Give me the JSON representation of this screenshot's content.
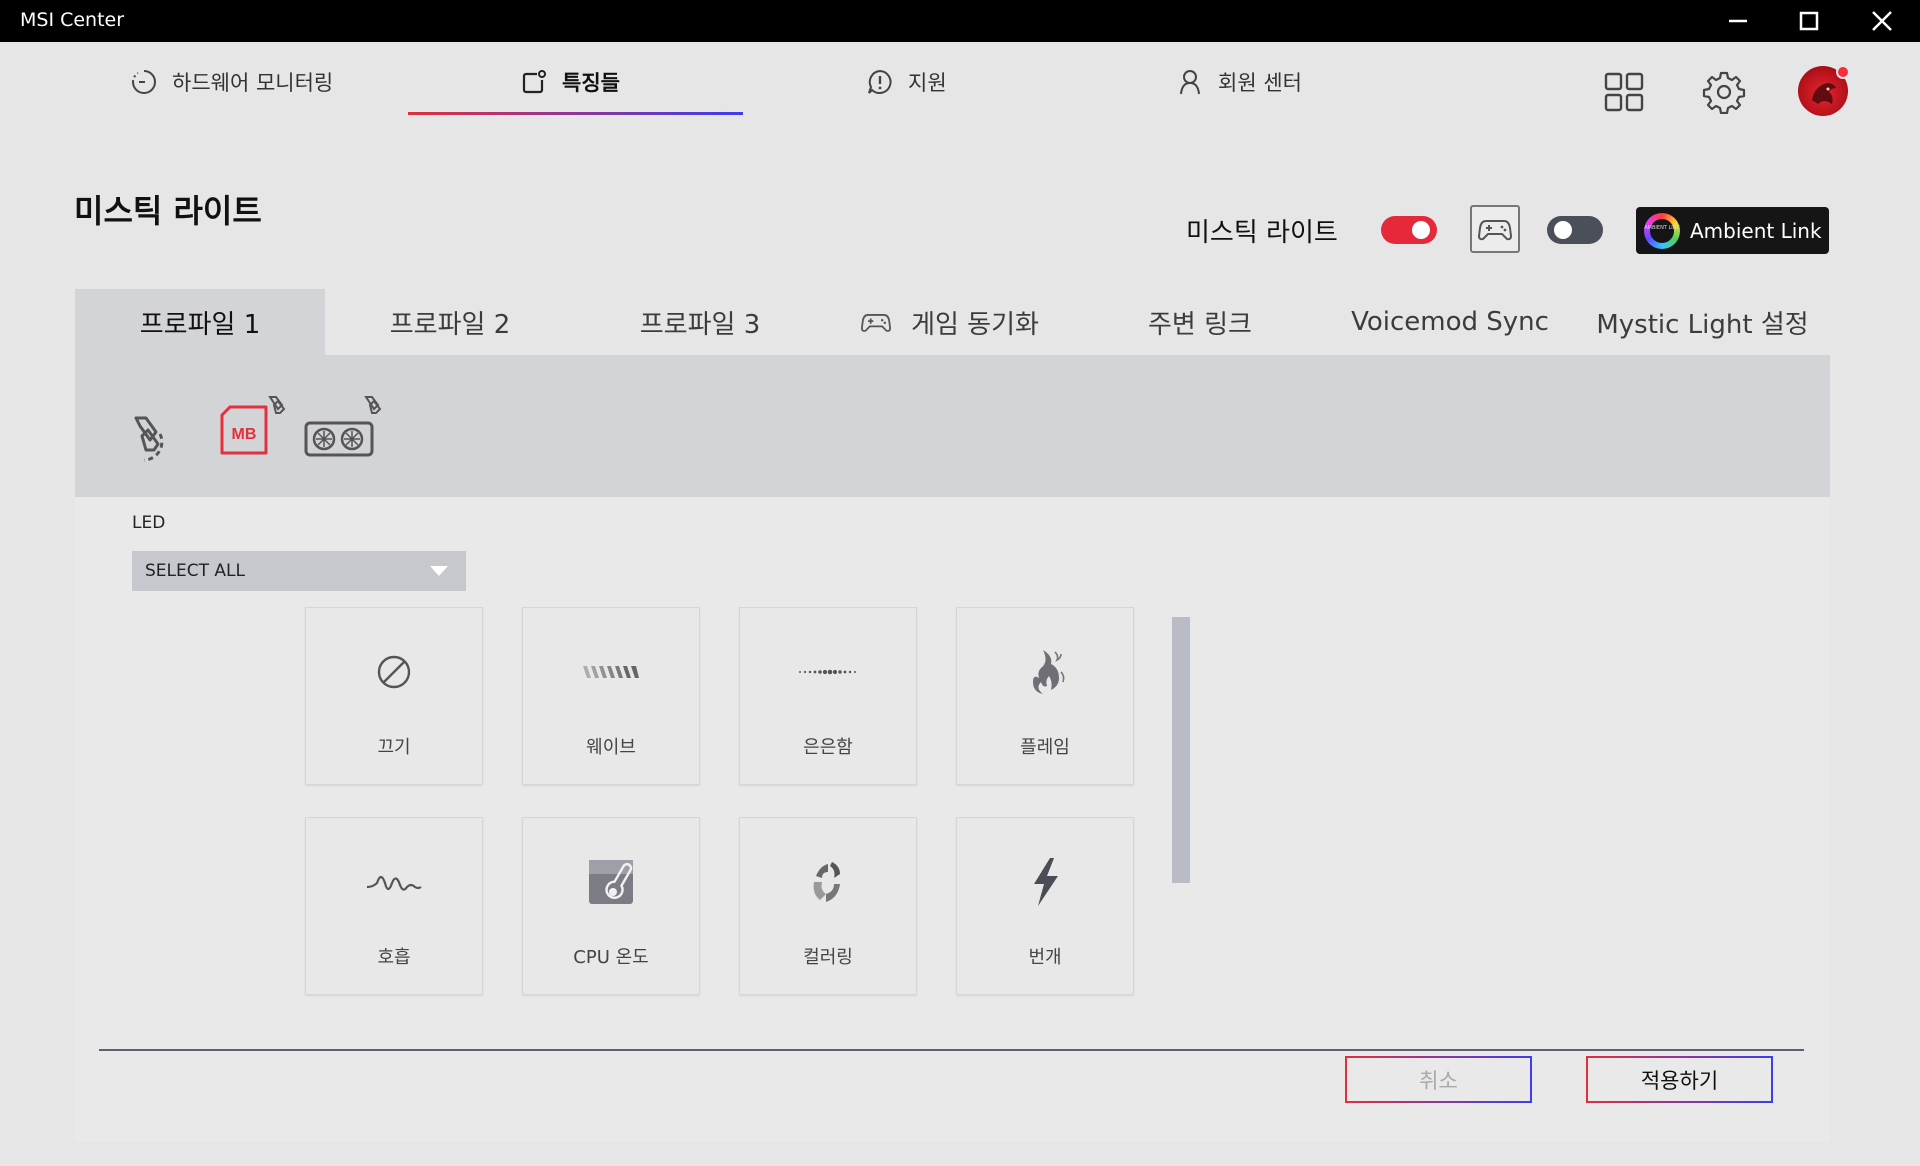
{
  "window": {
    "title": "MSI Center"
  },
  "nav": {
    "tabs": [
      {
        "label": "하드웨어 모니터링",
        "icon": "gauge-icon"
      },
      {
        "label": "특징들",
        "icon": "features-icon",
        "active": true
      },
      {
        "label": "지원",
        "icon": "support-alert-icon"
      },
      {
        "label": "회원 센터",
        "icon": "user-icon"
      }
    ],
    "accent_gradient": [
      "#e0303c",
      "#3d3df0"
    ]
  },
  "page": {
    "title": "미스틱 라이트"
  },
  "header": {
    "mystic_light_label": "미스틱 라이트",
    "mystic_light_toggle": "on",
    "game_sync_toggle": "off",
    "ambient_link_label": "Ambient Link",
    "ambient_logo_text": "AMBIENT LINK"
  },
  "profile_tabs": [
    {
      "label": "프로파일 1",
      "active": true
    },
    {
      "label": "프로파일 2"
    },
    {
      "label": "프로파일 3"
    },
    {
      "label": "게임 동기화",
      "icon": "gamepad-icon"
    },
    {
      "label": "주변 링크"
    },
    {
      "label": "Voicemod Sync"
    },
    {
      "label": "Mystic Light 설정"
    }
  ],
  "devices": [
    {
      "name": "link-sync-icon"
    },
    {
      "name": "motherboard",
      "badge": "MB",
      "selected": true
    },
    {
      "name": "graphics-card"
    }
  ],
  "led": {
    "label": "LED",
    "select_value": "SELECT ALL"
  },
  "effects": [
    {
      "label": "끄기",
      "icon": "off-icon"
    },
    {
      "label": "웨이브",
      "icon": "wave-icon"
    },
    {
      "label": "은은함",
      "icon": "subtle-icon"
    },
    {
      "label": "플레임",
      "icon": "flame-icon"
    },
    {
      "label": "호흡",
      "icon": "breathing-icon"
    },
    {
      "label": "CPU 온도",
      "icon": "cpu-temperature-icon"
    },
    {
      "label": "컬러링",
      "icon": "color-cycle-icon"
    },
    {
      "label": "번개",
      "icon": "lightning-icon"
    }
  ],
  "buttons": {
    "cancel": "취소",
    "apply": "적용하기"
  },
  "colors": {
    "toggle_on": "#e5293a",
    "toggle_off": "#4b4f59",
    "mb_selected": "#e3303c"
  }
}
